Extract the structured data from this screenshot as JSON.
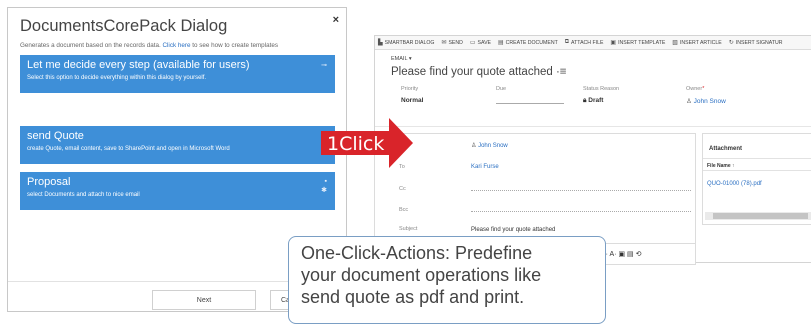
{
  "dialog": {
    "title": "DocumentsCorePack Dialog",
    "close_glyph": "×",
    "subtitle_prefix": "Generates a document based on the records data. ",
    "subtitle_link": "Click here",
    "subtitle_suffix": " to see how to create templates",
    "options": [
      {
        "title": "Let me decide every step (available for users)",
        "description": "Select this option to decide everything within this dialog by yourself.",
        "icon": "pin-icon"
      },
      {
        "title": "send Quote",
        "description": "create Quote, email content, save to SharePoint and open in Microsoft Word",
        "icon": "pin-icon"
      },
      {
        "title": "Proposal",
        "description": "select Documents and attach to nice email",
        "icon": "pin-icon"
      }
    ],
    "buttons": {
      "next": "Next",
      "cancel": "Ca"
    },
    "accent_color": "#3e8fd8"
  },
  "arrow": {
    "label": "1Click",
    "color": "#d9242a"
  },
  "crm": {
    "commands": [
      {
        "icon": "▙",
        "label": "SMARTBAR DIALOG"
      },
      {
        "icon": "✉",
        "label": "SEND"
      },
      {
        "icon": "▭",
        "label": "SAVE"
      },
      {
        "icon": "▤",
        "label": "CREATE DOCUMENT"
      },
      {
        "icon": "⧉",
        "label": "ATTACH FILE"
      },
      {
        "icon": "▣",
        "label": "INSERT TEMPLATE"
      },
      {
        "icon": "▧",
        "label": "INSERT ARTICLE"
      },
      {
        "icon": "↻",
        "label": "INSERT SIGNATUR"
      }
    ],
    "record_type": "EMAIL ▾",
    "record_title": "Please find your quote attached",
    "record_title_menu": "·≡",
    "header": {
      "priority_label": "Priority",
      "priority_value": "Normal",
      "due_label": "Due",
      "status_label": "Status Reason",
      "status_value": "Draft",
      "owner_label": "Owner",
      "owner_required": "*",
      "owner_value": "John Snow"
    },
    "fields": {
      "from_label": "m",
      "from_value": "John Snow",
      "to_label": "To",
      "to_value": "Kari Furse",
      "cc_label": "Cc",
      "bcc_label": "Bcc",
      "subject_label": "Subject",
      "subject_value": "Please find your quote attached"
    },
    "attachment": {
      "title": "Attachment",
      "column_header": "File Name ↑",
      "file": "QUO-01000 (78).pdf"
    },
    "editor_tools": "A· A· ▣ ▤ ⟲"
  },
  "callout": {
    "lines": [
      "One-Click-Actions: Predefine",
      "your document operations like",
      "send quote as pdf and print."
    ]
  }
}
